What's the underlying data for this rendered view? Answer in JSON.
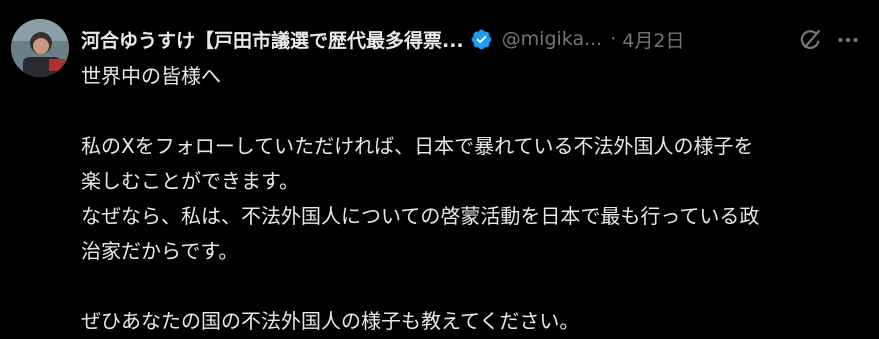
{
  "post": {
    "author": {
      "display_name": "河合ゆうすけ【戸田市議選で歴代最多得票...",
      "handle": "@migika...",
      "verified": true,
      "verified_color": "#1d9bf0"
    },
    "separator": "·",
    "date": "4月2日",
    "icons": {
      "verified": "verified-badge-icon",
      "grok": "grok-icon",
      "more": "more-options-icon"
    },
    "text": {
      "line1": "世界中の皆様へ",
      "line2": "私のXをフォローしていただければ、日本で暴れている不法外国人の様子を",
      "line3": "楽しむことができます。",
      "line4": "なぜなら、私は、不法外国人についての啓蒙活動を日本で最も行っている政",
      "line5": "治家だからです。",
      "line6": "ぜひあなたの国の不法外国人の様子も教えてください。"
    }
  },
  "colors": {
    "background": "#000000",
    "primary_text": "#e7e9ea",
    "secondary_text": "#71767b",
    "accent": "#1d9bf0"
  }
}
